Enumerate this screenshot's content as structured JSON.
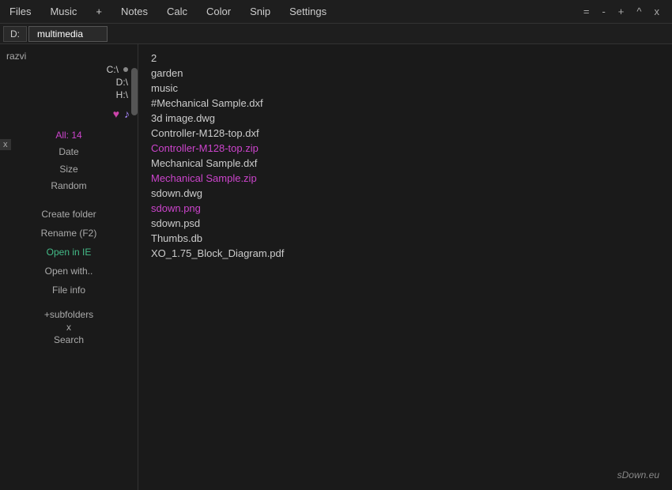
{
  "menu": {
    "items": [
      {
        "label": "Files",
        "id": "files"
      },
      {
        "label": "Music",
        "id": "music"
      },
      {
        "label": "+",
        "id": "add"
      },
      {
        "label": "Notes",
        "id": "notes"
      },
      {
        "label": "Calc",
        "id": "calc"
      },
      {
        "label": "Color",
        "id": "color"
      },
      {
        "label": "Snip",
        "id": "snip"
      },
      {
        "label": "Settings",
        "id": "settings"
      }
    ],
    "controls": [
      {
        "label": "=",
        "id": "eq"
      },
      {
        "label": "-",
        "id": "min"
      },
      {
        "label": "+",
        "id": "plus"
      },
      {
        "label": "^",
        "id": "restore"
      },
      {
        "label": "x",
        "id": "close"
      }
    ]
  },
  "path_bar": {
    "drive": "D:",
    "path": "multimedia"
  },
  "sidebar": {
    "drives": [
      {
        "label": "C:\\",
        "has_dot": true
      },
      {
        "label": "D:\\",
        "has_dot": false
      },
      {
        "label": "H:\\",
        "has_dot": false
      }
    ],
    "user": "razvi",
    "all_count": "All: 14",
    "sort_options": [
      "Date",
      "Size",
      "Random"
    ],
    "actions": [
      {
        "label": "Create folder",
        "color": "normal"
      },
      {
        "label": "Rename (F2)",
        "color": "normal"
      },
      {
        "label": "Open in IE",
        "color": "green"
      },
      {
        "label": "Open with..",
        "color": "normal"
      },
      {
        "label": "File info",
        "color": "normal"
      }
    ],
    "subfolders": "+subfolders",
    "x_label": "x",
    "search_label": "Search"
  },
  "files": [
    {
      "name": "2",
      "type": "number",
      "color": "normal"
    },
    {
      "name": "garden",
      "type": "folder",
      "color": "normal"
    },
    {
      "name": "music",
      "type": "folder",
      "color": "normal"
    },
    {
      "name": "#Mechanical Sample.dxf",
      "type": "file",
      "color": "normal"
    },
    {
      "name": "3d image.dwg",
      "type": "file",
      "color": "normal"
    },
    {
      "name": "Controller-M128-top.dxf",
      "type": "file",
      "color": "normal"
    },
    {
      "name": "Controller-M128-top.zip",
      "type": "file",
      "color": "purple"
    },
    {
      "name": "Mechanical Sample.dxf",
      "type": "file",
      "color": "normal"
    },
    {
      "name": "Mechanical Sample.zip",
      "type": "file",
      "color": "purple"
    },
    {
      "name": "sdown.dwg",
      "type": "file",
      "color": "normal"
    },
    {
      "name": "sdown.png",
      "type": "file",
      "color": "purple"
    },
    {
      "name": "sdown.psd",
      "type": "file",
      "color": "normal"
    },
    {
      "name": "Thumbs.db",
      "type": "file",
      "color": "normal"
    },
    {
      "name": "XO_1.75_Block_Diagram.pdf",
      "type": "file",
      "color": "normal"
    }
  ],
  "branding": "sDown.eu",
  "icons": {
    "heart": "♥",
    "music": "♪",
    "x_close": "x",
    "scrollbar": ""
  }
}
